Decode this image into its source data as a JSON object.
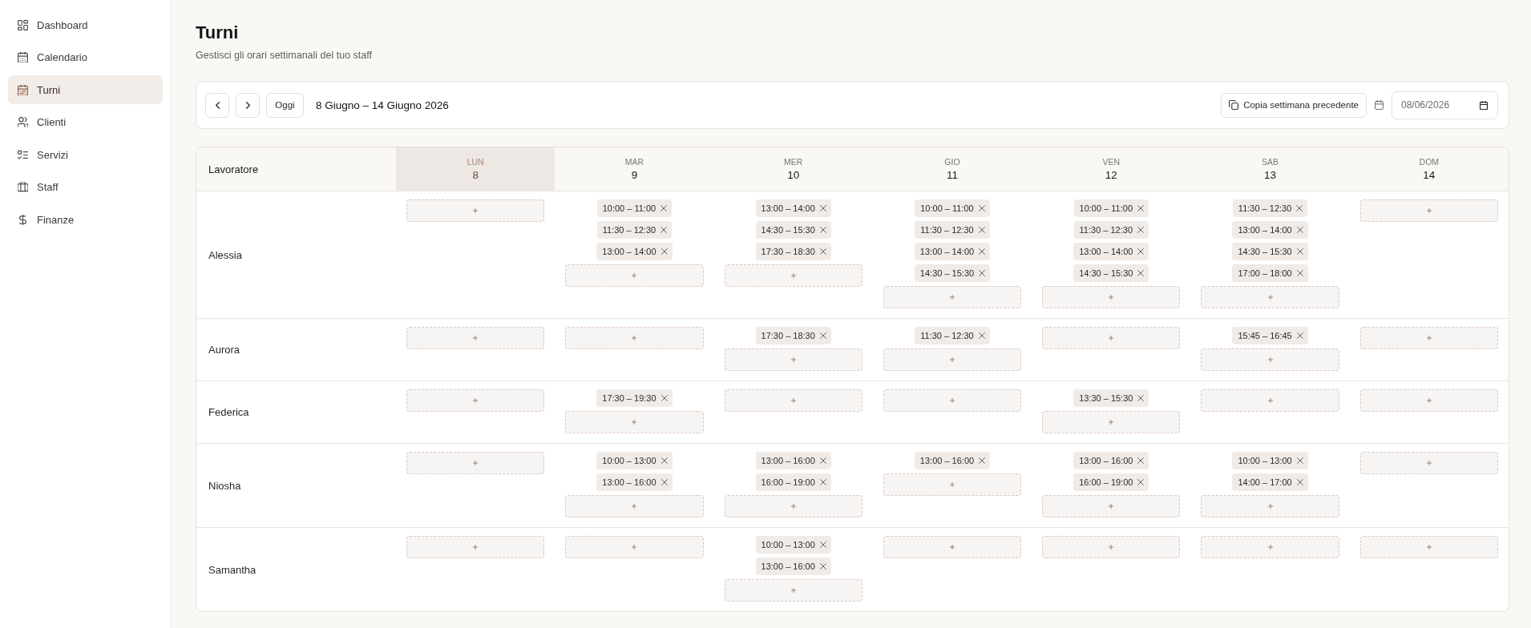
{
  "sidebar": {
    "items": [
      {
        "label": "Dashboard",
        "selected": false
      },
      {
        "label": "Calendario",
        "selected": false
      },
      {
        "label": "Turni",
        "selected": true
      },
      {
        "label": "Clienti",
        "selected": false
      },
      {
        "label": "Servizi",
        "selected": false
      },
      {
        "label": "Staff",
        "selected": false
      },
      {
        "label": "Finanze",
        "selected": false
      }
    ]
  },
  "header": {
    "title": "Turni",
    "subtitle": "Gestisci gli orari settimanali del tuo staff"
  },
  "toolbar": {
    "today_button": "Oggi",
    "range": "8 Giugno – 14 Giugno 2026",
    "copy_button": "Copia settimana precedente",
    "date_value": "08/06/2026"
  },
  "schedule": {
    "worker_column": "Lavoratore",
    "days": [
      {
        "weekday": "LUN",
        "day": "8",
        "selected": true
      },
      {
        "weekday": "MAR",
        "day": "9",
        "selected": false
      },
      {
        "weekday": "MER",
        "day": "10",
        "selected": false
      },
      {
        "weekday": "GIO",
        "day": "11",
        "selected": false
      },
      {
        "weekday": "VEN",
        "day": "12",
        "selected": false
      },
      {
        "weekday": "SAB",
        "day": "13",
        "selected": false
      },
      {
        "weekday": "DOM",
        "day": "14",
        "selected": false
      }
    ],
    "rows": [
      {
        "name": "Alessia",
        "cells": [
          {},
          {
            "shifts": [
              "10:00 – 11:00",
              "11:30 – 12:30",
              "13:00 – 14:00"
            ]
          },
          {
            "shifts": [
              "13:00 – 14:00",
              "14:30 – 15:30",
              "17:30 – 18:30"
            ]
          },
          {
            "shifts": [
              "10:00 – 11:00",
              "11:30 – 12:30",
              "13:00 – 14:00",
              "14:30 – 15:30"
            ]
          },
          {
            "shifts": [
              "10:00 – 11:00",
              "11:30 – 12:30",
              "13:00 – 14:00",
              "14:30 – 15:30"
            ]
          },
          {
            "shifts": [
              "11:30 – 12:30",
              "13:00 – 14:00",
              "14:30 – 15:30",
              "17:00 – 18:00"
            ]
          },
          {}
        ]
      },
      {
        "name": "Aurora",
        "cells": [
          {},
          {},
          {
            "shifts": [
              "17:30 – 18:30"
            ]
          },
          {
            "shifts": [
              "11:30 – 12:30"
            ]
          },
          {},
          {
            "shifts": [
              "15:45 – 16:45"
            ]
          },
          {}
        ]
      },
      {
        "name": "Federica",
        "cells": [
          {},
          {
            "shifts": [
              "17:30 – 19:30"
            ]
          },
          {},
          {},
          {
            "shifts": [
              "13:30 – 15:30"
            ]
          },
          {},
          {}
        ]
      },
      {
        "name": "Niosha",
        "cells": [
          {},
          {
            "shifts": [
              "10:00 – 13:00",
              "13:00 – 16:00"
            ]
          },
          {
            "shifts": [
              "13:00 – 16:00",
              "16:00 – 19:00"
            ]
          },
          {
            "shifts": [
              "13:00 – 16:00"
            ]
          },
          {
            "shifts": [
              "13:00 – 16:00",
              "16:00 – 19:00"
            ]
          },
          {
            "shifts": [
              "10:00 – 13:00",
              "14:00 – 17:00"
            ]
          },
          {}
        ]
      },
      {
        "name": "Samantha",
        "cells": [
          {},
          {},
          {
            "shifts": [
              "10:00 – 13:00",
              "13:00 – 16:00"
            ]
          },
          {},
          {},
          {},
          {}
        ]
      }
    ]
  }
}
